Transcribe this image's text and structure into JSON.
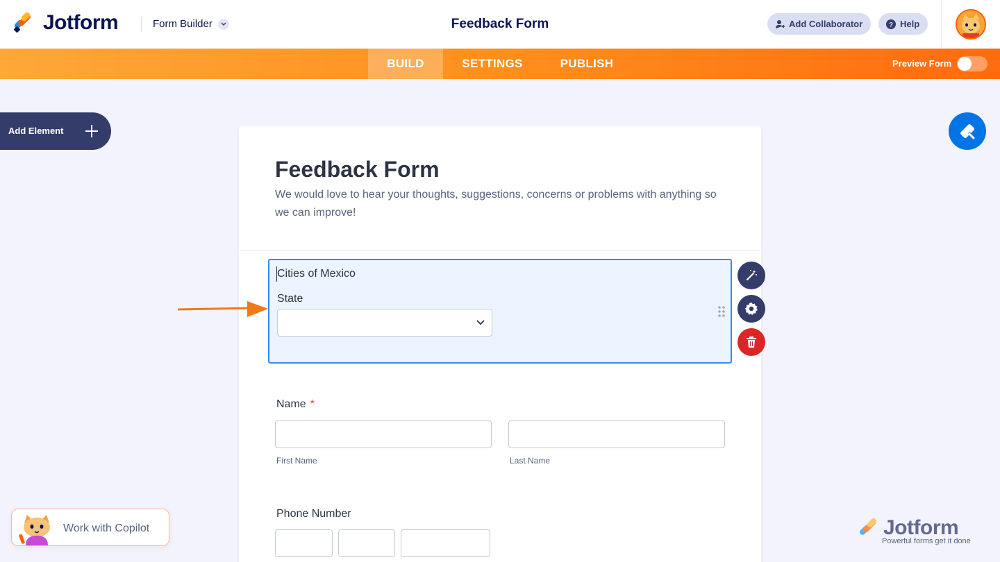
{
  "header": {
    "logo_text": "Jotform",
    "form_builder_label": "Form Builder",
    "form_title": "Feedback Form",
    "add_collaborator_label": "Add Collaborator",
    "help_label": "Help"
  },
  "nav": {
    "tabs": [
      {
        "label": "BUILD",
        "active": true
      },
      {
        "label": "SETTINGS",
        "active": false
      },
      {
        "label": "PUBLISH",
        "active": false
      }
    ],
    "preview_label": "Preview Form",
    "preview_on": false
  },
  "sidebar": {
    "add_element_label": "Add Element"
  },
  "form": {
    "title": "Feedback Form",
    "subtitle": "We would love to hear your thoughts, suggestions, concerns or problems with anything so we can improve!",
    "selected_field": {
      "title": "Cities of Mexico",
      "select_label": "State",
      "select_value": ""
    },
    "name_field": {
      "label": "Name",
      "required_mark": "*",
      "first_sublabel": "First Name",
      "last_sublabel": "Last Name"
    },
    "phone_field": {
      "label": "Phone Number"
    }
  },
  "copilot": {
    "label": "Work with Copilot"
  },
  "brand": {
    "name": "Jotform",
    "tagline": "Powerful forms get it done"
  },
  "colors": {
    "orange_start": "#ffa739",
    "orange_end": "#ff6b10",
    "navy": "#0a1551",
    "selection_blue": "#2f8ef0",
    "delete_red": "#dc2626",
    "paint_blue": "#0075e3"
  }
}
